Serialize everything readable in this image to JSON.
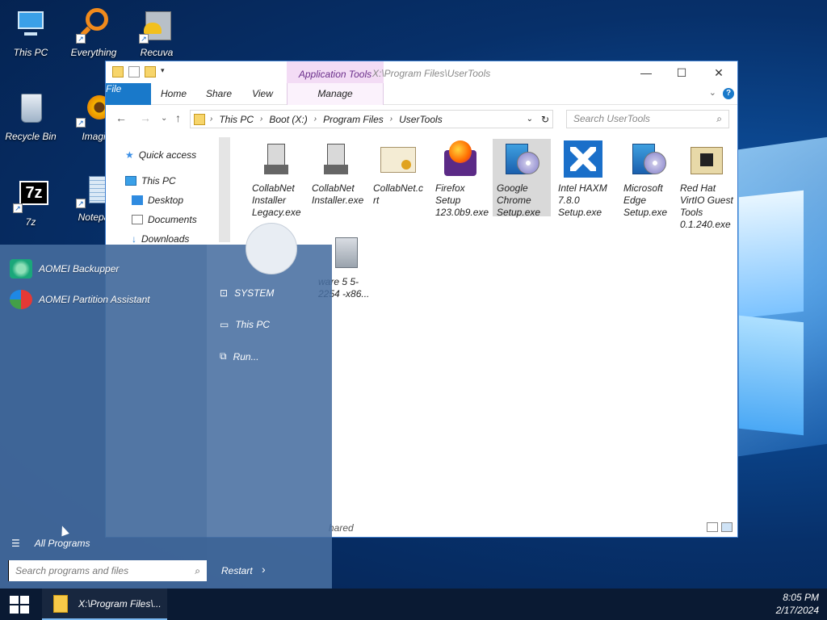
{
  "desktop": {
    "icons": [
      {
        "label": "This PC",
        "icon": "computer-icon"
      },
      {
        "label": "Everything",
        "icon": "magnifier-icon"
      },
      {
        "label": "Recuva",
        "icon": "recuva-icon"
      },
      {
        "label": "Recycle Bin",
        "icon": "recycle-bin-icon"
      },
      {
        "label": "Imagi",
        "icon": "flower-icon"
      },
      {
        "label": "7z",
        "icon": "7z-icon"
      },
      {
        "label": "Notepa",
        "icon": "notepad-icon"
      }
    ]
  },
  "explorer": {
    "title": "X:\\Program Files\\UserTools",
    "context_tab": "Application Tools",
    "ribbon_tabs": [
      "File",
      "Home",
      "Share",
      "View",
      "Manage"
    ],
    "breadcrumb": [
      "This PC",
      "Boot (X:)",
      "Program Files",
      "UserTools"
    ],
    "search_placeholder": "Search UserTools",
    "nav": [
      "Quick access",
      "This PC",
      "Desktop",
      "Documents",
      "Downloads"
    ],
    "files": [
      {
        "name": "CollabNet Installer Legacy.exe",
        "icon": "installer-computer-icon",
        "selected": false
      },
      {
        "name": "CollabNet Installer.exe",
        "icon": "installer-computer-icon",
        "selected": false
      },
      {
        "name": "CollabNet.c rt",
        "icon": "certificate-icon",
        "selected": false
      },
      {
        "name": "Firefox Setup 123.0b9.exe",
        "icon": "firefox-setup-icon",
        "selected": false
      },
      {
        "name": "Google Chrome Setup.exe",
        "icon": "setup-disc-icon",
        "selected": true
      },
      {
        "name": "Intel HAXM 7.8.0 Setup.exe",
        "icon": "haxm-icon",
        "selected": false
      },
      {
        "name": "Microsoft Edge Setup.exe",
        "icon": "setup-disc-icon",
        "selected": false
      },
      {
        "name": "Red Hat VirtIO Guest Tools 0.1.240.exe",
        "icon": "virtio-box-icon",
        "selected": false
      },
      {
        "name": "ware 5 5-2254 -x86...",
        "icon": "setup-box-icon",
        "selected": false
      }
    ],
    "status_text": "hared"
  },
  "start_menu": {
    "apps": [
      "AOMEI Backupper",
      "AOMEI Partition Assistant"
    ],
    "right_items": [
      "SYSTEM",
      "This PC",
      "Run..."
    ],
    "all_programs": "All Programs",
    "search_placeholder": "Search programs and files",
    "power_button": "Restart"
  },
  "taskbar": {
    "app_label": "X:\\Program Files\\...",
    "time": "8:05 PM",
    "date": "2/17/2024"
  }
}
